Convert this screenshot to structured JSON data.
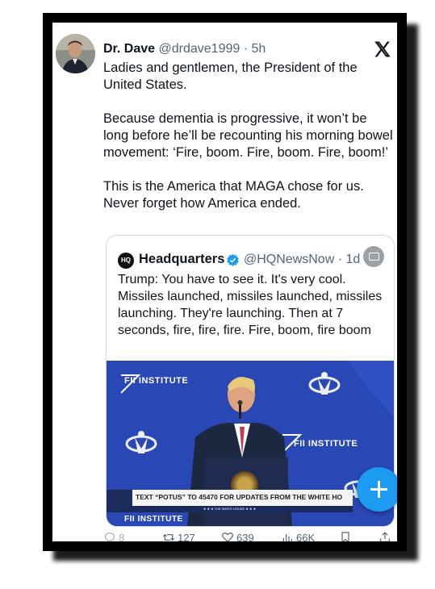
{
  "tweet": {
    "author_name": "Dr. Dave",
    "author_handle": "@drdave1999",
    "separator": " · ",
    "time": "5h",
    "paragraphs": [
      "Ladies and gentlemen, the President of the United States.",
      "Because dementia is progressive, it won’t be long before he’ll be recounting his morning bowel movement: ‘Fire, boom. Fire, boom. Fire, boom!’",
      "This is the America that MAGA chose for us. Never forget how America ended."
    ]
  },
  "quote": {
    "logo_text": "HQ",
    "author_name": "Headquarters",
    "author_handle": "@HQNewsNow",
    "time": "1d",
    "text": "Trump: You have to see it. It's very cool. Missiles launched, missiles launched, missiles launching. They're launching. Then at 7 seconds, fire, fire, fire. Fire, boom, fire boom",
    "media": {
      "institute_label_1": "FII INSTITUTE",
      "institute_label_2": "FII INSTITUTE",
      "institute_label_3": "FII INSTITUTE",
      "chyron_text": "TEXT “POTUS” TO 45470 FOR UPDATES FROM THE WHITE HO",
      "chyron_sub": "★ ★ ★  THE WHITE HOUSE  ★ ★ ★"
    }
  },
  "actions": {
    "replies": "8",
    "retweets": "127",
    "likes": "639",
    "views": "66K"
  },
  "colors": {
    "accent": "#1d9bf0",
    "text_primary": "#0f1419",
    "text_secondary": "#536471",
    "media_background": "#2a47b6"
  },
  "icons": [
    "x-logo-icon",
    "verified-badge-icon",
    "captions-icon",
    "compose-plus-icon",
    "reply-icon",
    "retweet-icon",
    "like-icon",
    "views-icon",
    "bookmark-icon",
    "share-icon"
  ]
}
